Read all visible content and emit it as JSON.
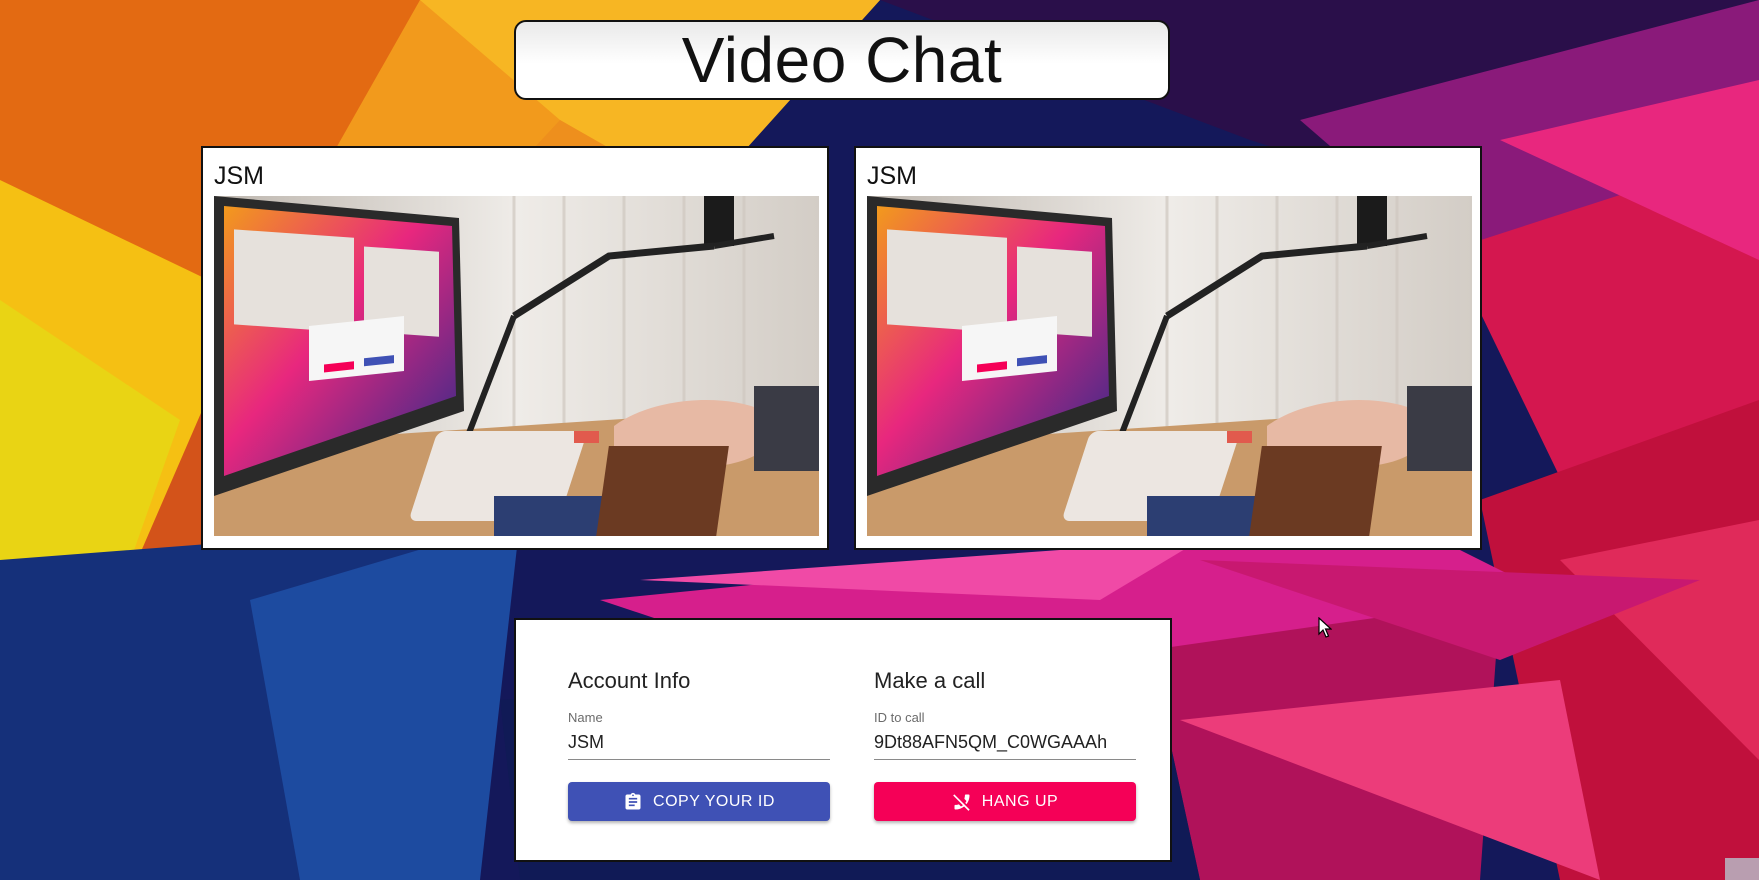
{
  "app": {
    "title": "Video Chat"
  },
  "videos": [
    {
      "name": "JSM"
    },
    {
      "name": "JSM"
    }
  ],
  "account": {
    "heading": "Account Info",
    "name_label": "Name",
    "name_value": "JSM",
    "copy_button": "COPY YOUR ID",
    "copy_icon": "clipboard-icon"
  },
  "call": {
    "heading": "Make a call",
    "id_label": "ID to call",
    "id_value": "9Dt88AFN5QM_C0WGAAAh",
    "hangup_button": "HANG UP",
    "hangup_icon": "phone-disabled-icon"
  },
  "colors": {
    "primary": "#3f51b5",
    "secondary": "#f50057"
  }
}
